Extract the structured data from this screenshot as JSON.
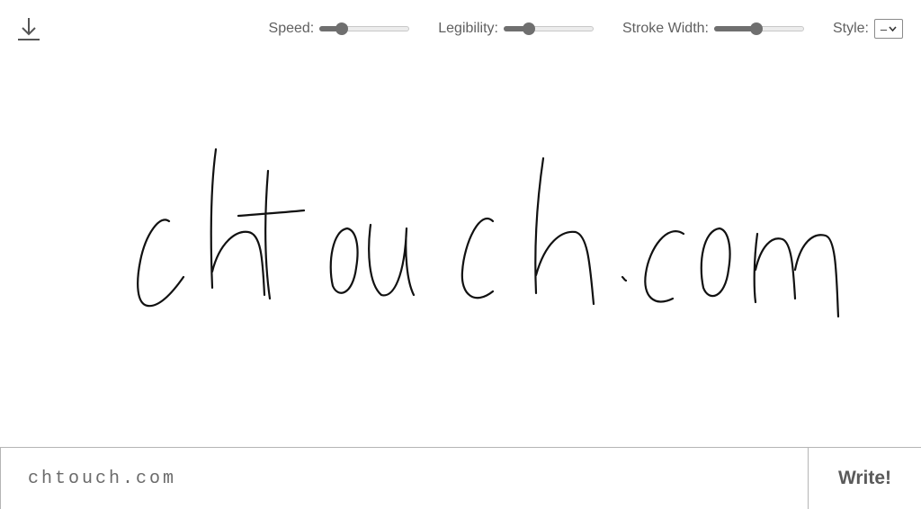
{
  "toolbar": {
    "download_icon": "download-icon",
    "speed_label": "Speed:",
    "speed_value": 0.25,
    "legibility_label": "Legibility:",
    "legibility_value": 0.28,
    "stroke_width_label": "Stroke Width:",
    "stroke_width_value": 0.47,
    "style_label": "Style:",
    "style_value": "–"
  },
  "canvas": {
    "rendered_text": "chtouch.com"
  },
  "input": {
    "value": "chtouch.com"
  },
  "write_button": {
    "label": "Write!"
  },
  "colors": {
    "ink": "#111111",
    "slider_fill": "#6f6f6f",
    "slider_track": "#ececec",
    "border": "#b5b5b5"
  }
}
